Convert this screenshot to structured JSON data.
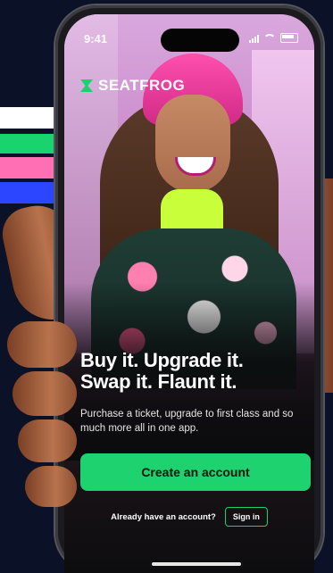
{
  "status_bar": {
    "time": "9:41"
  },
  "brand": {
    "name": "SEATFROG",
    "accent_color": "#1ed36f"
  },
  "hero": {
    "headline_line1": "Buy it. Upgrade it.",
    "headline_line2": "Swap it. Flaunt it.",
    "subtext": "Purchase a ticket, upgrade to first class and so much more all in one app."
  },
  "actions": {
    "create_account_label": "Create an account",
    "have_account_text": "Already have an account?",
    "sign_in_label": "Sign in"
  },
  "decor": {
    "stripe_colors": [
      "#ffffff",
      "#19d36f",
      "#ff6fb4",
      "#2c45ff"
    ],
    "background_color": "#0b1126"
  }
}
